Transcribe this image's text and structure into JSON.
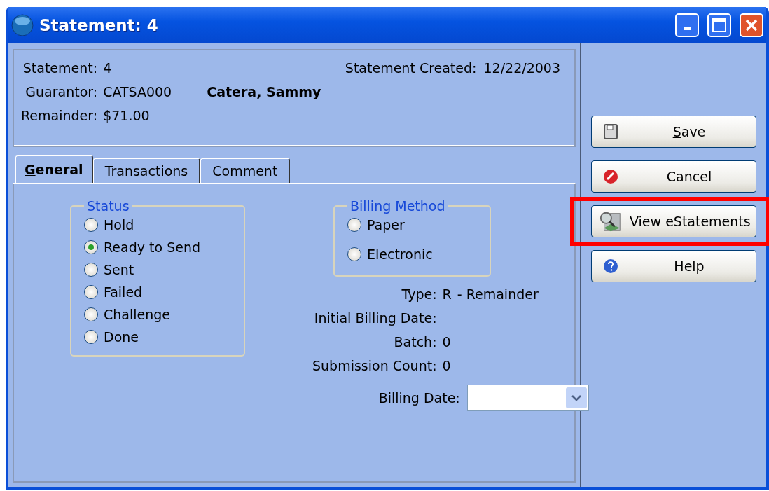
{
  "window": {
    "title": "Statement: 4"
  },
  "header": {
    "fields": [
      {
        "label": "Statement:",
        "value": "4"
      },
      {
        "label": "Guarantor:",
        "value": "CATSA000",
        "name": "Catera, Sammy"
      },
      {
        "label": "Remainder:",
        "value": "$71.00"
      }
    ],
    "created": {
      "label": "Statement Created:",
      "value": "12/22/2003"
    }
  },
  "tabs": [
    {
      "label": "General",
      "selected": true,
      "underline_first": true
    },
    {
      "label": "Transactions",
      "selected": false,
      "underline_first": true
    },
    {
      "label": "Comment",
      "selected": false,
      "underline_first": true
    }
  ],
  "status": {
    "title": "Status",
    "options": [
      {
        "label": "Hold",
        "selected": false
      },
      {
        "label": "Ready to Send",
        "selected": true
      },
      {
        "label": "Sent",
        "selected": false
      },
      {
        "label": "Failed",
        "selected": false
      },
      {
        "label": "Challenge",
        "selected": false
      },
      {
        "label": "Done",
        "selected": false
      }
    ]
  },
  "billing_method": {
    "title": "Billing Method",
    "options": [
      {
        "label": "Paper",
        "selected": false
      },
      {
        "label": "Electronic",
        "selected": false
      }
    ]
  },
  "details": [
    {
      "label": "Type:",
      "value": "R",
      "extra": "- Remainder"
    },
    {
      "label": "Initial Billing Date:"
    },
    {
      "label": "Batch:",
      "value": "0"
    },
    {
      "label": "Submission Count:",
      "value": "0"
    }
  ],
  "billing_date": {
    "label": "Billing Date:"
  },
  "buttons": [
    {
      "label": "Save",
      "kind": "save",
      "underline_first": true
    },
    {
      "label": "Cancel",
      "kind": "cancel",
      "underline_first": false
    },
    {
      "label": "View eStatements",
      "kind": "view",
      "underline_first": false,
      "highlighted": true
    },
    {
      "label": "Help",
      "kind": "help",
      "underline_first": true
    }
  ]
}
